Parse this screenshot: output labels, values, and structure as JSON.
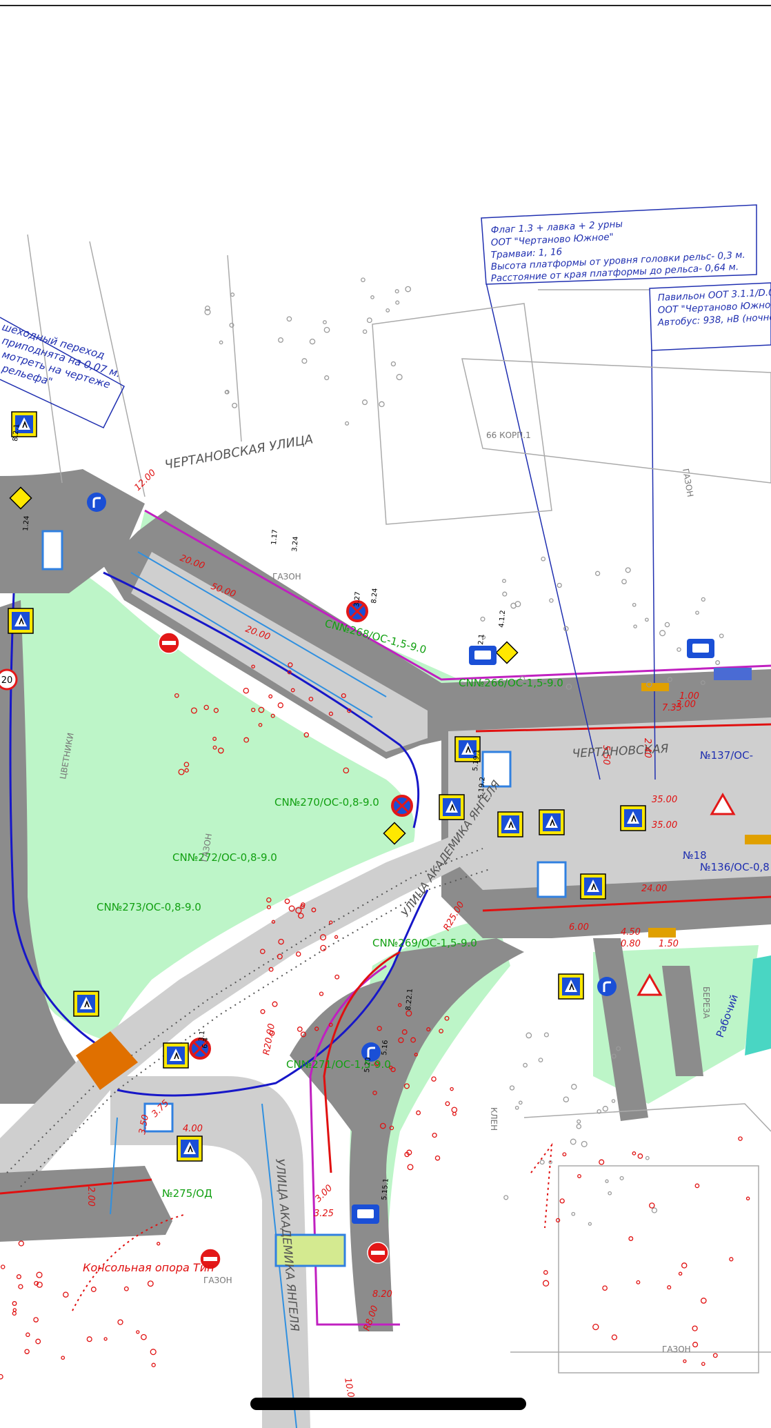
{
  "colors": {
    "road": "#8c8c8c",
    "road_light": "#cfcfcf",
    "lawn": "#bdf5c8",
    "lawn_bright": "#a8f0b4",
    "curb": "#c020c0",
    "tram_edge": "#1717c8",
    "red_line": "#e01010",
    "green_text": "#12a012",
    "blue_text": "#1f2fb0",
    "sign_blue": "#1a4fd6",
    "sign_red": "#e31818",
    "sign_yellow": "#ffe800",
    "crossing_fill": "#e07000"
  },
  "notes": {
    "stop_tram": {
      "lines": [
        "Флаг 1.3 + лавка + 2 урны",
        "ООТ \"Чертаново Южное\"",
        "Трамваи: 1, 16",
        "Высота платформы от уровня головки рельс- 0,3 м.",
        "Расстояние от края платформы до рельса- 0,64 м."
      ]
    },
    "stop_bus": {
      "lines": [
        "Павильон ООТ 3.1.1/D.0",
        "ООТ \"Чертаново Южное",
        "Автобус: 938, нВ (ночно"
      ]
    },
    "crossing": {
      "lines": [
        "шеходный переход",
        "приподнята на 0,07 м.",
        "мотреть на чертеже",
        "рельефа\""
      ]
    },
    "console": "Консольная опора Тип"
  },
  "streets": {
    "chertanovskaya_top": "ЧЕРТАНОВСКАЯ УЛИЦА",
    "chertanovskaya_road": "ЧЕРТАНОВСКАЯ",
    "yangelya_a": "УЛИЦА АКАДЕМИКА ЯНГЕЛЯ",
    "yangelya_b": "УЛИЦА АКАДЕМИКА ЯНГЕЛЯ"
  },
  "objects": {
    "lawn_codes": [
      "СN№270/ОС-0,8-9.0",
      "СN№272/ОС-0,8-9.0",
      "СN№273/ОС-0,8-9.0",
      "СN№269/ОС-1,5-9.0",
      "СN№268/ОС-1,5-9.0",
      "СN№271/ОС-1,5-9.0",
      "СN№266/ОС-1,5-9.0",
      "№275/ОД"
    ],
    "road_codes": [
      "№137/ОС-",
      "№136/ОС-0,8",
      "№18"
    ]
  },
  "labels": {
    "gazon": "ГАЗОН",
    "shchetniki": "ЦВЕТНИКИ",
    "korp": "66 КОРП.1",
    "bereza": "БЕРЕЗА",
    "klen": "КЛЕН",
    "rabochiy": "Рабочий",
    "sign_codes": [
      "5.19.1",
      "5.19.2",
      "1.17",
      "3.24",
      "3.27",
      "8.24",
      "4.1.2",
      "2.1",
      "3.1",
      "5.20",
      "1.24",
      "8.2.1",
      "6.4",
      "5.15.1",
      "8.22.1",
      "5.16"
    ],
    "dimensions": [
      "20.00",
      "12.00",
      "50.00",
      "20.00",
      "35.00",
      "35.00",
      "24.00",
      "6.00",
      "4.00",
      "3.75",
      "3.50",
      "3.25",
      "3.00",
      "8.20",
      "10.00",
      "R20.00",
      "R25.00",
      "R8.00",
      "2.00",
      "1.00",
      "5.50",
      "3.00",
      "4.50",
      "0.80",
      "1.50",
      "7.35",
      "2.40"
    ]
  },
  "signs": [
    {
      "kind": "pedestrian"
    },
    {
      "kind": "pedestrian"
    },
    {
      "kind": "pedestrian"
    },
    {
      "kind": "pedestrian"
    },
    {
      "kind": "pedestrian"
    },
    {
      "kind": "pedestrian"
    },
    {
      "kind": "pedestrian"
    },
    {
      "kind": "pedestrian"
    },
    {
      "kind": "pedestrian"
    },
    {
      "kind": "pedestrian"
    },
    {
      "kind": "pedestrian"
    },
    {
      "kind": "pedestrian"
    },
    {
      "kind": "no-entry"
    },
    {
      "kind": "no-entry"
    },
    {
      "kind": "no-entry"
    },
    {
      "kind": "no-stopping"
    },
    {
      "kind": "no-stopping"
    },
    {
      "kind": "no-stopping"
    },
    {
      "kind": "turn-arrow"
    },
    {
      "kind": "turn-arrow"
    },
    {
      "kind": "turn-arrow"
    },
    {
      "kind": "priority"
    },
    {
      "kind": "priority"
    },
    {
      "kind": "priority"
    },
    {
      "kind": "bus-stop"
    },
    {
      "kind": "bus-stop"
    },
    {
      "kind": "bus-stop"
    },
    {
      "kind": "warning"
    },
    {
      "kind": "warning"
    },
    {
      "kind": "speed-limit"
    }
  ],
  "speed_limit": "20"
}
